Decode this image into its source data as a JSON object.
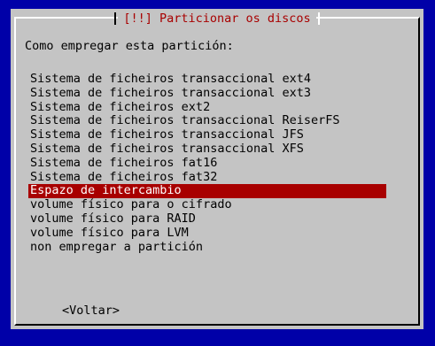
{
  "dialog": {
    "title": "[!!] Particionar os discos",
    "question": "Como empregar esta partición:",
    "options": [
      "Sistema de ficheiros transaccional ext4",
      "Sistema de ficheiros transaccional ext3",
      "Sistema de ficheiros ext2",
      "Sistema de ficheiros transaccional ReiserFS",
      "Sistema de ficheiros transaccional JFS",
      "Sistema de ficheiros transaccional XFS",
      "Sistema de ficheiros fat16",
      "Sistema de ficheiros fat32",
      "Espazo de intercambio",
      "volume físico para o cifrado",
      "volume físico para RAID",
      "volume físico para LVM",
      "non empregar a partición"
    ],
    "selected_index": 8,
    "back_label": "<Voltar>"
  },
  "colors": {
    "screen_background": "#0000a8",
    "dialog_background": "#c4c4c4",
    "title_color": "#a80000",
    "selection_background": "#a80000",
    "selection_text": "#ffffff"
  }
}
